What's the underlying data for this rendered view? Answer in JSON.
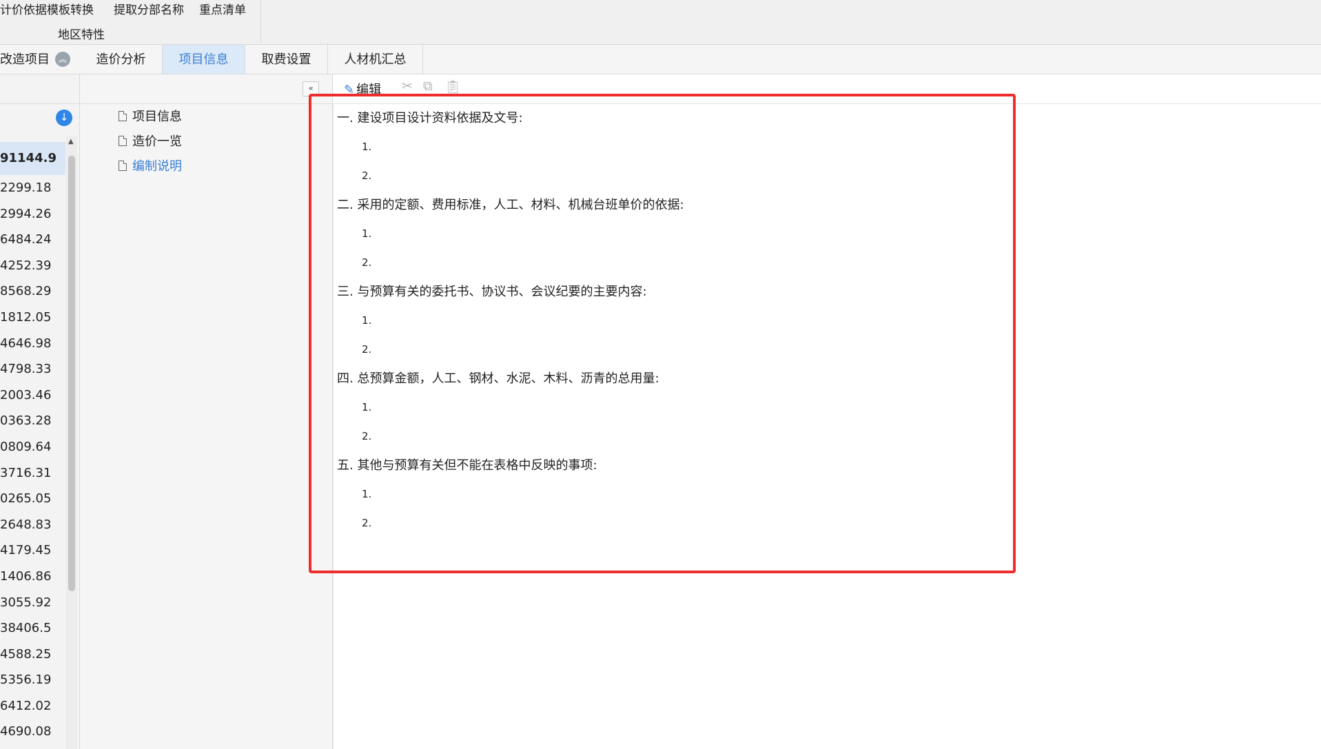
{
  "ribbon": {
    "row1": [
      "计价依据模板转换",
      "提取分部名称",
      "重点清单"
    ],
    "row2": "地区特性"
  },
  "tabs": {
    "project_label": "改造项目",
    "items": [
      "造价分析",
      "项目信息",
      "取费设置",
      "人材机汇总"
    ],
    "active": "项目信息"
  },
  "left_panel": {
    "values": [
      "91144.9",
      "2299.18",
      "2994.26",
      "6484.24",
      "4252.39",
      "8568.29",
      "1812.05",
      "4646.98",
      "4798.33",
      "2003.46",
      "0363.28",
      "0809.64",
      "3716.31",
      "0265.05",
      "2648.83",
      "4179.45",
      "1406.86",
      "3055.92",
      "38406.5",
      "4588.25",
      "5356.19",
      "6412.02",
      "4690.08"
    ]
  },
  "tree": {
    "items": [
      "项目信息",
      "造价一览",
      "编制说明"
    ],
    "selected": "编制说明"
  },
  "editor": {
    "edit_label": "编辑",
    "toolbar_icons": [
      "cut-icon",
      "copy-icon",
      "paste-icon"
    ],
    "sections": [
      {
        "title": "一.  建设项目设计资料依据及文号:",
        "items": [
          "1.",
          "2."
        ]
      },
      {
        "title": "二.  采用的定额、费用标准，人工、材料、机械台班单价的依据:",
        "items": [
          "1.",
          "2."
        ]
      },
      {
        "title": "三.  与预算有关的委托书、协议书、会议纪要的主要内容:",
        "items": [
          "1.",
          "2."
        ]
      },
      {
        "title": "四.  总预算金额，人工、钢材、水泥、木料、沥青的总用量:",
        "items": [
          "1.",
          "2."
        ]
      },
      {
        "title": "五.  其他与预算有关但不能在表格中反映的事项:",
        "items": [
          "1.",
          "2."
        ]
      }
    ]
  },
  "colors": {
    "accent": "#3a7fd4",
    "active_tab_bg": "#dce9f8",
    "highlight_box": "#ee2c2c"
  }
}
